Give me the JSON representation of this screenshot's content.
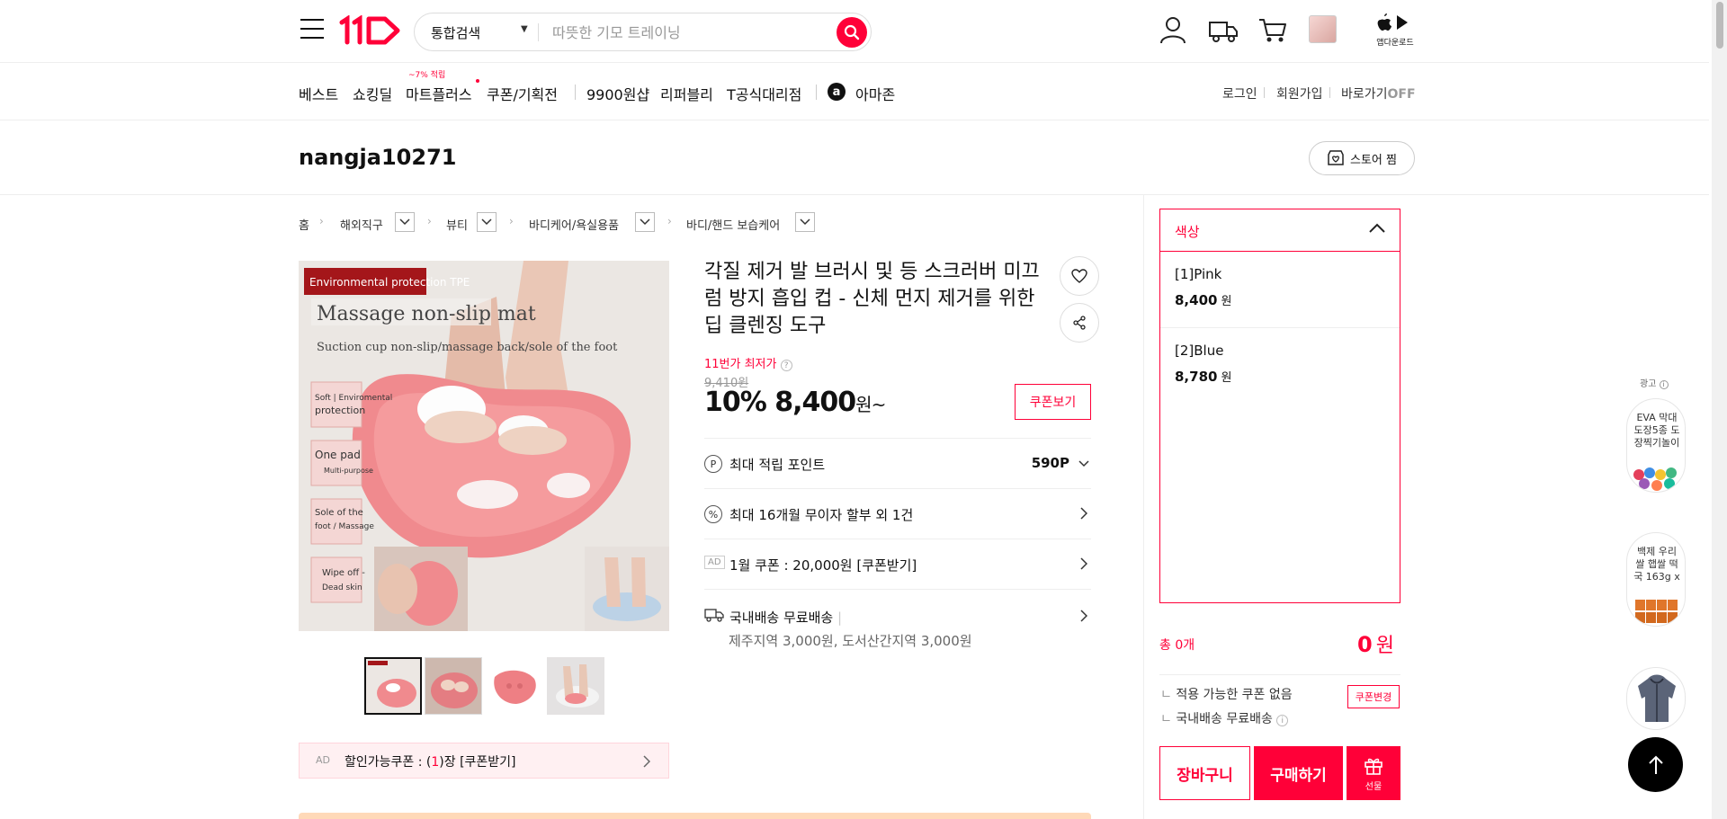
{
  "header": {
    "logo": "11ST",
    "search": {
      "category": "통합검색",
      "placeholder": "따뜻한 기모 트레이닝"
    },
    "app_download": "앱다운로드"
  },
  "nav": {
    "items": [
      "베스트",
      "쇼킹딜",
      "마트플러스",
      "쿠폰/기획전",
      "9900원샵",
      "리퍼블리",
      "T공식대리점",
      "아마존"
    ],
    "mart_tag": "~7% 적립",
    "login": "로그인",
    "signup": "회원가입",
    "shortcut": "바로가기",
    "shortcut_state": "OFF"
  },
  "store": {
    "name": "nangja10271",
    "follow_label": "스토어 찜"
  },
  "breadcrumb": [
    "홈",
    "해외직구",
    "뷰티",
    "바디케어/욕실용품",
    "바디/핸드 보습케어"
  ],
  "image_text": {
    "tag": "Environmental protection TPE",
    "headline": "Massage non-slip mat",
    "sub": "Suction cup non-slip/massage back/sole of the foot",
    "f1a": "Soft | Enviromental",
    "f1b": "protection",
    "f2a": "One pad",
    "f2b": "Multi-purpose",
    "f3a": "Sole of the",
    "f3b": "foot / Massage",
    "f4a": "Wipe off -",
    "f4b": "Dead skin"
  },
  "product": {
    "title": "각질 제거 발 브러시 및 등 스크러버 미끄럼 방지 흡입 컵 - 신체 먼지 제거를 위한 딥 클렌징 도구",
    "lowest_label": "11번가 최저가",
    "original_price": "9,410원",
    "discount": "10%",
    "price": "8,400",
    "price_unit": "원~",
    "coupon_view": "쿠폰보기",
    "points_label": "최대 적립 포인트",
    "points_value": "590P",
    "installment": "최대 16개월 무이자 할부 외 1건",
    "ad_tag": "AD",
    "coupon_ad": "1월 쿠폰 : 20,000원 [쿠폰받기]",
    "shipping": "국내배송 무료배송",
    "shipping_sub": "제주지역 3,000원, 도서산간지역 3,000원"
  },
  "ad_coupon_bar": {
    "tag": "AD",
    "text_prefix": "할인가능쿠폰 : (",
    "count": "1",
    "text_suffix": ")장 [쿠폰받기]"
  },
  "options": {
    "header": "색상",
    "items": [
      {
        "name": "[1]Pink",
        "price": "8,400",
        "unit": "원"
      },
      {
        "name": "[2]Blue",
        "price": "8,780",
        "unit": "원"
      }
    ],
    "total_label": "총 0개",
    "total_value": "0",
    "total_unit": "원",
    "coupon_note": "적용 가능한 쿠폰 없음",
    "coupon_change": "쿠폰변경",
    "shipping_note": "국내배송 무료배송",
    "cart": "장바구니",
    "buy": "구매하기",
    "gift": "선물"
  },
  "side_ads": {
    "label": "광고",
    "ad1": "EVA 막대 도장5종 도장찍기놀이",
    "ad2": "백제 우리 쌀 햅쌀 떡국 163g x"
  },
  "colors": {
    "accent": "#ff0038",
    "mat_pink": "#f08a8e"
  }
}
